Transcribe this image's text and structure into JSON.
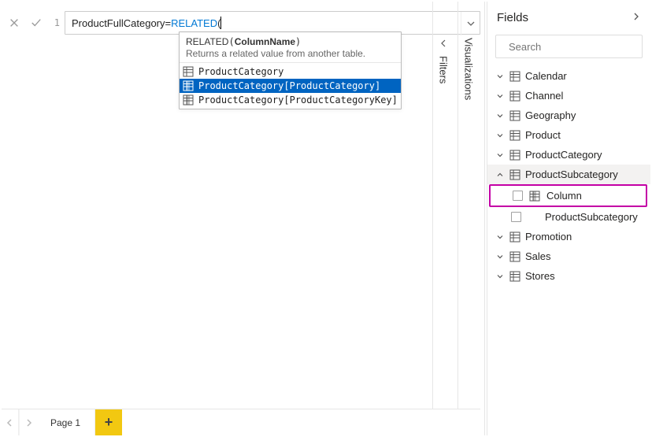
{
  "formula_bar": {
    "line_number": "1",
    "column_name": "ProductFullCategory",
    "equals": "=",
    "function_name": "RELATED",
    "open_paren": "("
  },
  "intellisense": {
    "signature_fn": "RELATED",
    "signature_param": "ColumnName",
    "description": "Returns a related value from another table.",
    "items": [
      {
        "label": "ProductCategory",
        "kind": "table",
        "selected": false
      },
      {
        "label": "ProductCategory[ProductCategory]",
        "kind": "column",
        "selected": true
      },
      {
        "label": "ProductCategory[ProductCategoryKey]",
        "kind": "column",
        "selected": false
      }
    ]
  },
  "collapsed_panes": {
    "filters": "Filters",
    "visualizations": "Visualizations"
  },
  "fields_pane": {
    "title": "Fields",
    "search_placeholder": "Search",
    "tables": [
      {
        "name": "Calendar",
        "expanded": false
      },
      {
        "name": "Channel",
        "expanded": false
      },
      {
        "name": "Geography",
        "expanded": false
      },
      {
        "name": "Product",
        "expanded": false
      },
      {
        "name": "ProductCategory",
        "expanded": false
      },
      {
        "name": "ProductSubcategory",
        "expanded": true,
        "columns": [
          {
            "name": "Column",
            "has_glyph": true,
            "highlighted": true
          },
          {
            "name": "ProductSubcategory",
            "has_glyph": false,
            "highlighted": false
          }
        ]
      },
      {
        "name": "Promotion",
        "expanded": false
      },
      {
        "name": "Sales",
        "expanded": false
      },
      {
        "name": "Stores",
        "expanded": false
      }
    ]
  },
  "tabbar": {
    "page_label": "Page 1",
    "add_label": "+"
  }
}
